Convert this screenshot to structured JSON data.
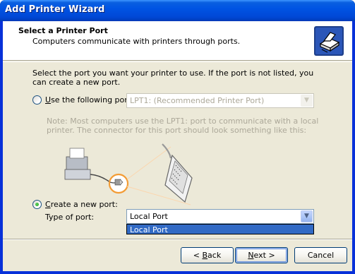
{
  "window": {
    "title": "Add Printer Wizard"
  },
  "header": {
    "title": "Select a Printer Port",
    "subtitle": "Computers communicate with printers through ports.",
    "icon": "printer-wizard-icon"
  },
  "intro": "Select the port you want your printer to use.  If the port is not listed, you can create a new port.",
  "option_existing": {
    "label_prefix": "U",
    "label_rest": "se the following port:",
    "selected": false,
    "select_value": "LPT1: (Recommended Printer Port)"
  },
  "note": "Note: Most computers use the LPT1: port to communicate with a local printer. The connector for this port should look something like this:",
  "option_new": {
    "label_prefix": "C",
    "label_rest": "reate a new port:",
    "selected": true,
    "type_label": "Type of port:",
    "select_value": "Local Port",
    "dropdown_items": [
      "Local Port"
    ]
  },
  "buttons": {
    "back": {
      "prefix": "< ",
      "accel": "B",
      "rest": "ack"
    },
    "next": {
      "accel": "N",
      "rest": "ext >"
    },
    "cancel": "Cancel"
  },
  "colors": {
    "title_bar": "#0054e3",
    "client_bg": "#ece9d8",
    "selection": "#316ac5",
    "accent_orange": "#f39c35"
  }
}
